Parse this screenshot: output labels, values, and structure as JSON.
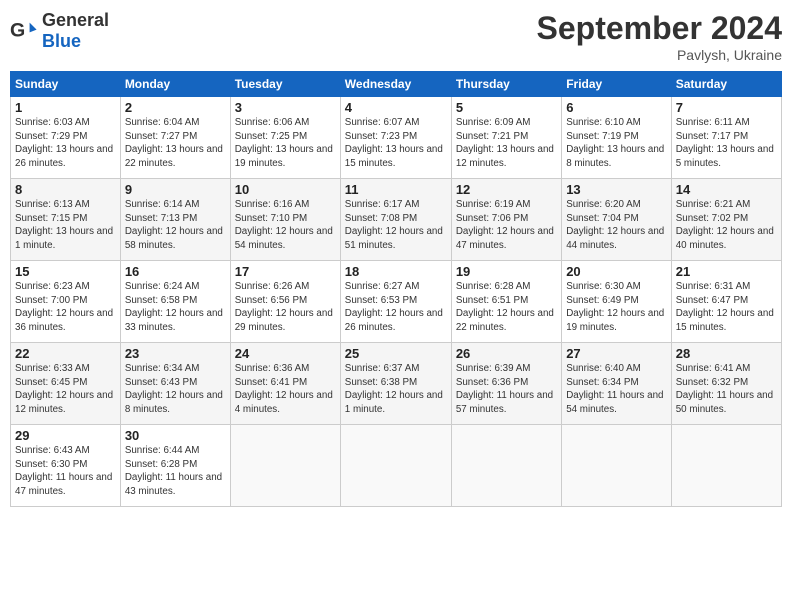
{
  "header": {
    "logo_general": "General",
    "logo_blue": "Blue",
    "month_title": "September 2024",
    "location": "Pavlysh, Ukraine"
  },
  "weekdays": [
    "Sunday",
    "Monday",
    "Tuesday",
    "Wednesday",
    "Thursday",
    "Friday",
    "Saturday"
  ],
  "weeks": [
    [
      {
        "day": "1",
        "sunrise": "6:03 AM",
        "sunset": "7:29 PM",
        "daylight": "13 hours and 26 minutes."
      },
      {
        "day": "2",
        "sunrise": "6:04 AM",
        "sunset": "7:27 PM",
        "daylight": "13 hours and 22 minutes."
      },
      {
        "day": "3",
        "sunrise": "6:06 AM",
        "sunset": "7:25 PM",
        "daylight": "13 hours and 19 minutes."
      },
      {
        "day": "4",
        "sunrise": "6:07 AM",
        "sunset": "7:23 PM",
        "daylight": "13 hours and 15 minutes."
      },
      {
        "day": "5",
        "sunrise": "6:09 AM",
        "sunset": "7:21 PM",
        "daylight": "13 hours and 12 minutes."
      },
      {
        "day": "6",
        "sunrise": "6:10 AM",
        "sunset": "7:19 PM",
        "daylight": "13 hours and 8 minutes."
      },
      {
        "day": "7",
        "sunrise": "6:11 AM",
        "sunset": "7:17 PM",
        "daylight": "13 hours and 5 minutes."
      }
    ],
    [
      {
        "day": "8",
        "sunrise": "6:13 AM",
        "sunset": "7:15 PM",
        "daylight": "13 hours and 1 minute."
      },
      {
        "day": "9",
        "sunrise": "6:14 AM",
        "sunset": "7:13 PM",
        "daylight": "12 hours and 58 minutes."
      },
      {
        "day": "10",
        "sunrise": "6:16 AM",
        "sunset": "7:10 PM",
        "daylight": "12 hours and 54 minutes."
      },
      {
        "day": "11",
        "sunrise": "6:17 AM",
        "sunset": "7:08 PM",
        "daylight": "12 hours and 51 minutes."
      },
      {
        "day": "12",
        "sunrise": "6:19 AM",
        "sunset": "7:06 PM",
        "daylight": "12 hours and 47 minutes."
      },
      {
        "day": "13",
        "sunrise": "6:20 AM",
        "sunset": "7:04 PM",
        "daylight": "12 hours and 44 minutes."
      },
      {
        "day": "14",
        "sunrise": "6:21 AM",
        "sunset": "7:02 PM",
        "daylight": "12 hours and 40 minutes."
      }
    ],
    [
      {
        "day": "15",
        "sunrise": "6:23 AM",
        "sunset": "7:00 PM",
        "daylight": "12 hours and 36 minutes."
      },
      {
        "day": "16",
        "sunrise": "6:24 AM",
        "sunset": "6:58 PM",
        "daylight": "12 hours and 33 minutes."
      },
      {
        "day": "17",
        "sunrise": "6:26 AM",
        "sunset": "6:56 PM",
        "daylight": "12 hours and 29 minutes."
      },
      {
        "day": "18",
        "sunrise": "6:27 AM",
        "sunset": "6:53 PM",
        "daylight": "12 hours and 26 minutes."
      },
      {
        "day": "19",
        "sunrise": "6:28 AM",
        "sunset": "6:51 PM",
        "daylight": "12 hours and 22 minutes."
      },
      {
        "day": "20",
        "sunrise": "6:30 AM",
        "sunset": "6:49 PM",
        "daylight": "12 hours and 19 minutes."
      },
      {
        "day": "21",
        "sunrise": "6:31 AM",
        "sunset": "6:47 PM",
        "daylight": "12 hours and 15 minutes."
      }
    ],
    [
      {
        "day": "22",
        "sunrise": "6:33 AM",
        "sunset": "6:45 PM",
        "daylight": "12 hours and 12 minutes."
      },
      {
        "day": "23",
        "sunrise": "6:34 AM",
        "sunset": "6:43 PM",
        "daylight": "12 hours and 8 minutes."
      },
      {
        "day": "24",
        "sunrise": "6:36 AM",
        "sunset": "6:41 PM",
        "daylight": "12 hours and 4 minutes."
      },
      {
        "day": "25",
        "sunrise": "6:37 AM",
        "sunset": "6:38 PM",
        "daylight": "12 hours and 1 minute."
      },
      {
        "day": "26",
        "sunrise": "6:39 AM",
        "sunset": "6:36 PM",
        "daylight": "11 hours and 57 minutes."
      },
      {
        "day": "27",
        "sunrise": "6:40 AM",
        "sunset": "6:34 PM",
        "daylight": "11 hours and 54 minutes."
      },
      {
        "day": "28",
        "sunrise": "6:41 AM",
        "sunset": "6:32 PM",
        "daylight": "11 hours and 50 minutes."
      }
    ],
    [
      {
        "day": "29",
        "sunrise": "6:43 AM",
        "sunset": "6:30 PM",
        "daylight": "11 hours and 47 minutes."
      },
      {
        "day": "30",
        "sunrise": "6:44 AM",
        "sunset": "6:28 PM",
        "daylight": "11 hours and 43 minutes."
      },
      null,
      null,
      null,
      null,
      null
    ]
  ]
}
